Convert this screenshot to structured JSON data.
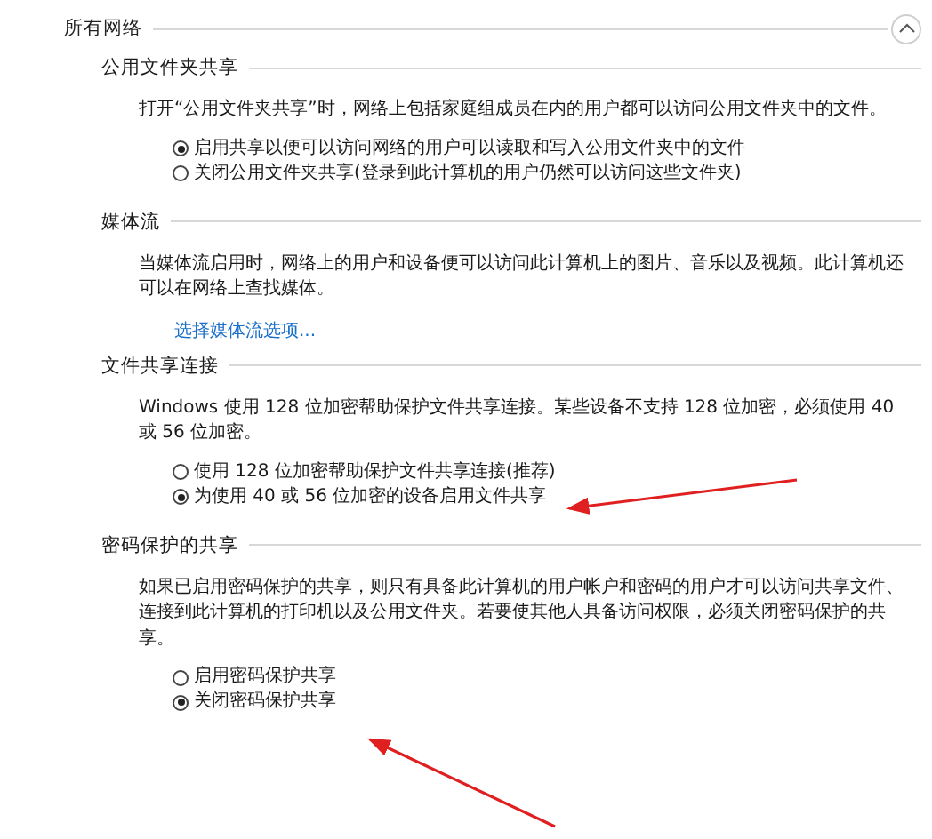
{
  "group": {
    "title": "所有网络",
    "expanded": true,
    "sections": [
      {
        "title": "公用文件夹共享",
        "description": "打开“公用文件夹共享”时，网络上包括家庭组成员在内的用户都可以访问公用文件夹中的文件。",
        "options": [
          {
            "label": "启用共享以便可以访问网络的用户可以读取和写入公用文件夹中的文件",
            "selected": true
          },
          {
            "label": "关闭公用文件夹共享(登录到此计算机的用户仍然可以访问这些文件夹)",
            "selected": false
          }
        ]
      },
      {
        "title": "媒体流",
        "description": "当媒体流启用时，网络上的用户和设备便可以访问此计算机上的图片、音乐以及视频。此计算机还可以在网络上查找媒体。",
        "link": "选择媒体流选项..."
      },
      {
        "title": "文件共享连接",
        "description": "Windows 使用 128 位加密帮助保护文件共享连接。某些设备不支持 128 位加密，必须使用 40 或 56 位加密。",
        "options": [
          {
            "label": "使用 128 位加密帮助保护文件共享连接(推荐)",
            "selected": false
          },
          {
            "label": "为使用 40 或 56 位加密的设备启用文件共享",
            "selected": true
          }
        ]
      },
      {
        "title": "密码保护的共享",
        "description": "如果已启用密码保护的共享，则只有具备此计算机的用户帐户和密码的用户才可以访问共享文件、连接到此计算机的打印机以及公用文件夹。若要使其他人具备访问权限，必须关闭密码保护的共享。",
        "options": [
          {
            "label": "启用密码保护共享",
            "selected": false
          },
          {
            "label": "关闭密码保护共享",
            "selected": true
          }
        ]
      }
    ]
  }
}
